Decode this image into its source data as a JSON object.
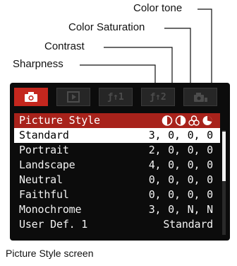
{
  "callouts": {
    "color_tone": "Color tone",
    "color_saturation": "Color Saturation",
    "contrast": "Contrast",
    "sharpness": "Sharpness"
  },
  "tabs": [
    {
      "icon": "camera-icon",
      "label": "",
      "active": true
    },
    {
      "icon": "playback-icon",
      "label": "",
      "active": false
    },
    {
      "icon": "setup1-icon",
      "label": "ƒ↑1",
      "active": false
    },
    {
      "icon": "setup2-icon",
      "label": "ƒ↑2",
      "active": false
    },
    {
      "icon": "custom-icon",
      "label": "",
      "active": false
    }
  ],
  "header": {
    "label": "Picture Style",
    "icons": [
      "sharpness-icon",
      "contrast-icon",
      "saturation-icon",
      "color-tone-icon"
    ]
  },
  "rows": [
    {
      "name": "Standard",
      "values": "3, 0, 0, 0",
      "selected": true
    },
    {
      "name": "Portrait",
      "values": "2, 0, 0, 0",
      "selected": false
    },
    {
      "name": "Landscape",
      "values": "4, 0, 0, 0",
      "selected": false
    },
    {
      "name": "Neutral",
      "values": "0, 0, 0, 0",
      "selected": false
    },
    {
      "name": "Faithful",
      "values": "0, 0, 0, 0",
      "selected": false
    },
    {
      "name": "Monochrome",
      "values": "3, 0, N, N",
      "selected": false
    },
    {
      "name": "User Def. 1",
      "values": "Standard",
      "selected": false
    }
  ],
  "caption": "Picture Style screen",
  "colors": {
    "accent": "#c4271e",
    "header_bg": "#a8221b",
    "screen_bg": "#0c0c0c"
  }
}
